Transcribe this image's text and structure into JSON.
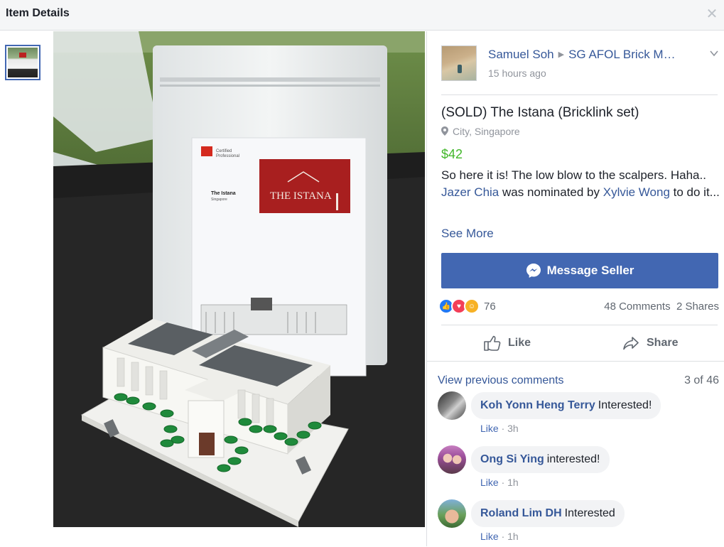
{
  "dialog": {
    "title": "Item Details",
    "close_icon": "close-icon"
  },
  "post": {
    "author": "Samuel Soh",
    "group": "SG AFOL Brick M…",
    "time": "15 hours ago",
    "title": "(SOLD) The Istana (Bricklink set)",
    "location": "City, Singapore",
    "price": "$42",
    "desc": {
      "part1": "So here it is! The low blow to the scalpers. Haha..",
      "mention1": "Jazer Chia",
      "part2": " was nominated by ",
      "mention2": "Xylvie Wong",
      "part3": " to do it..."
    },
    "see_more": "See More"
  },
  "message_button": {
    "label": "Message Seller"
  },
  "reactions": {
    "count": "76",
    "comments": "48 Comments",
    "shares": "2 Shares"
  },
  "actions": {
    "like": "Like",
    "share": "Share"
  },
  "comments": {
    "view_previous": "View previous comments",
    "page_count": "3 of 46",
    "items": [
      {
        "author": "Koh Yonn Heng Terry",
        "text": "Interested!",
        "like": "Like",
        "time": "3h"
      },
      {
        "author": "Ong Si Ying",
        "text": "interested!",
        "like": "Like",
        "time": "1h"
      },
      {
        "author": "Roland Lim DH",
        "text": "Interested",
        "like": "Like",
        "time": "1h"
      }
    ]
  },
  "product_box": {
    "brand_line1": "Certified",
    "brand_line2": "Professional",
    "name": "The Istana",
    "sub": "Singapore",
    "badge": "THE ISTANA"
  },
  "colors": {
    "accent": "#4267b2",
    "link": "#365899",
    "price": "#42b72a",
    "muted": "#90949c"
  }
}
